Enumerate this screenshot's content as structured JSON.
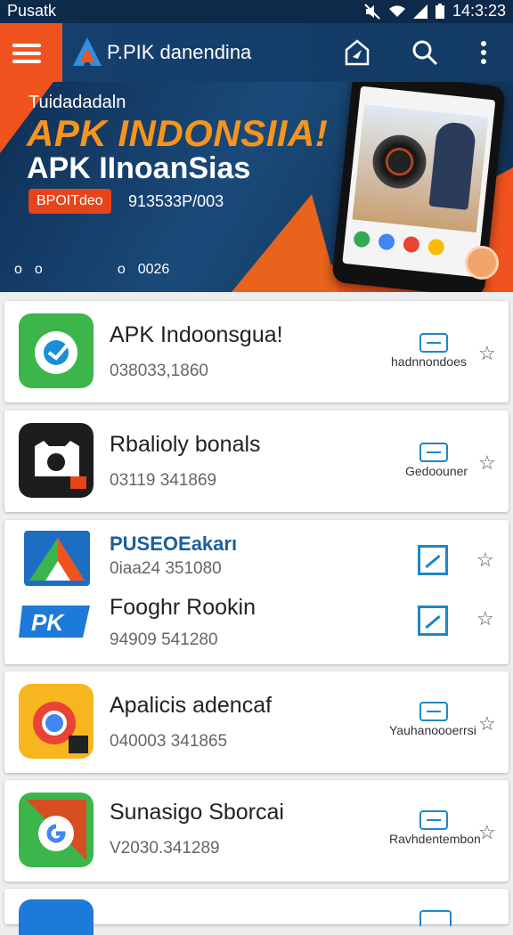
{
  "status_bar": {
    "left_label": "Pusatk",
    "time": "14:3:23"
  },
  "app_bar": {
    "title": "P.PIK danendina",
    "accent": "#f0531e"
  },
  "hero": {
    "kicker": "Tuidadadaln",
    "headline": "APK INDONSIIA!",
    "subheadline": "APK IInoanSias",
    "badge": "BPOITdeo",
    "code": "913533P/003",
    "page": "0026"
  },
  "apps": [
    {
      "name": "APK Indoonsgua!",
      "meta": "038033,1860",
      "action": "hadnnondoes"
    },
    {
      "name": "Rbalioly bonals",
      "meta": "03119 341869",
      "action": "Gedoouner"
    },
    {
      "title": "PUSEOEakarı",
      "meta": "0iaa24 351080",
      "name": "Fooghr Rookin",
      "meta2": "94909 541280"
    },
    {
      "name": "Apalicis adencaf",
      "meta": "040003 341865",
      "action": "Yauhanoooerrsi"
    },
    {
      "name": "Sunasigo Sborcai",
      "meta": "V2030.341289",
      "action": "Ravhdentembon"
    }
  ]
}
